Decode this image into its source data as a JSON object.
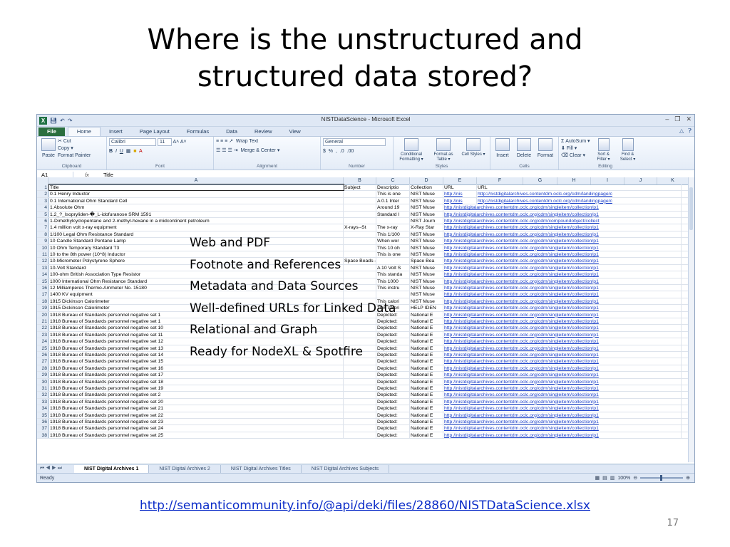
{
  "slide": {
    "title_line1": "Where is the unstructured and",
    "title_line2": "structured data stored?",
    "bullets": [
      "Web and PDF",
      "Footnote and References",
      "Metadata and Data Sources",
      "Well-defined URLs for Linked Data",
      "Relational and Graph",
      "Ready for NodeXL & Spotfire"
    ],
    "link": "http://semanticommunity.info/@api/deki/files/28860/NISTDataScience.xlsx",
    "page_number": "17"
  },
  "excel": {
    "window_title": "NISTDataScience  -  Microsoft Excel",
    "tabs": [
      "File",
      "Home",
      "Insert",
      "Page Layout",
      "Formulas",
      "Data",
      "Review",
      "View"
    ],
    "ribbon": {
      "clipboard": {
        "paste": "Paste",
        "cut": "Cut",
        "copy": "Copy ▾",
        "format_painter": "Format Painter",
        "label": "Clipboard"
      },
      "font": {
        "name": "Calibri",
        "size": "11",
        "label": "Font"
      },
      "alignment": {
        "wrap": "Wrap Text",
        "merge": "Merge & Center ▾",
        "label": "Alignment"
      },
      "number": {
        "format": "General",
        "label": "Number"
      },
      "styles": {
        "conditional": "Conditional Formatting ▾",
        "format_table": "Format as Table ▾",
        "cell_styles": "Cell Styles ▾",
        "label": "Styles"
      },
      "cells": {
        "insert": "Insert",
        "delete": "Delete",
        "format": "Format",
        "label": "Cells"
      },
      "editing": {
        "autosum": "AutoSum ▾",
        "fill": "Fill ▾",
        "clear": "Clear ▾",
        "sort": "Sort & Filter ▾",
        "find": "Find & Select ▾",
        "label": "Editing"
      }
    },
    "formula_bar": {
      "name_box": "A1",
      "fx": "fx",
      "content": "Title"
    },
    "columns": [
      "A",
      "B",
      "C",
      "D",
      "E",
      "F",
      "G",
      "H",
      "I",
      "J",
      "K"
    ],
    "rows": [
      [
        "1",
        "Title",
        "Subject",
        "Descriptio",
        "Collection",
        "URL",
        "URL"
      ],
      [
        "2",
        "0.1 Henry Inductor",
        "",
        "This is one",
        "NIST Muse",
        "http://nis",
        "http://nistdigitalarchives.contentdm.oclc.org/cdm/landingpage/c"
      ],
      [
        "3",
        "0.1 International Ohm Standard Cell",
        "",
        "A 0.1 Inter",
        "NIST Muse",
        "http://nis",
        "http://nistdigitalarchives.contentdm.oclc.org/cdm/landingpage/c"
      ],
      [
        "4",
        "1 Absolute Ohm",
        "",
        "Around 19",
        "NIST Muse",
        "http://nistdigitalarchives.contentdm.oclc.org/cdm/singleitem/collection/p1",
        ""
      ],
      [
        "5",
        "1,2_?_Isopryliden-�_L-idofuranose SRM 1591",
        "",
        "Standard I",
        "NIST Muse",
        "http://nistdigitalarchives.contentdm.oclc.org/cdm/singleitem/collection/p1",
        ""
      ],
      [
        "6",
        "1-Dimethylcyclopentane and 2-methyl-hexane in a midcontinent petroleum",
        "",
        "",
        "NIST Journ",
        "http://nistdigitalarchives.contentdm.oclc.org/cdm/compoundobject/collect",
        ""
      ],
      [
        "7",
        "1.4 million volt x-ray equipment",
        "X-rays--St",
        "The x-ray",
        "X-Ray Star",
        "http://nistdigitalarchives.contentdm.oclc.org/cdm/singleitem/collection/p1",
        ""
      ],
      [
        "8",
        "1/100 Legal Ohm Resistance Standard",
        "",
        "This 1/100",
        "NIST Muse",
        "http://nistdigitalarchives.contentdm.oclc.org/cdm/singleitem/collection/p1",
        ""
      ],
      [
        "9",
        "10 Candle Standard Pentane Lamp",
        "",
        "When wor",
        "NIST Muse",
        "http://nistdigitalarchives.contentdm.oclc.org/cdm/singleitem/collection/p1",
        ""
      ],
      [
        "10",
        "10 Ohm Temporary Standard T3",
        "",
        "This 10 oh",
        "NIST Muse",
        "http://nistdigitalarchives.contentdm.oclc.org/cdm/singleitem/collection/p1",
        ""
      ],
      [
        "11",
        "10 to the 8th power (10^8) Inductor",
        "",
        "This is one",
        "NIST Muse",
        "http://nistdigitalarchives.contentdm.oclc.org/cdm/singleitem/collection/p1",
        ""
      ],
      [
        "12",
        "10-Micrometer Polystyrene Sphere",
        "Space Beads--Photo",
        "",
        "Space Bea",
        "http://nistdigitalarchives.contentdm.oclc.org/cdm/singleitem/collection/p1",
        ""
      ],
      [
        "13",
        "10-Volt Standard",
        "",
        "A 10 Volt S",
        "NIST Muse",
        "http://nistdigitalarchives.contentdm.oclc.org/cdm/singleitem/collection/p1",
        ""
      ],
      [
        "14",
        "100-ohm British Association Type Resistor",
        "",
        "This standa",
        "NIST Muse",
        "http://nistdigitalarchives.contentdm.oclc.org/cdm/singleitem/collection/p1",
        ""
      ],
      [
        "15",
        "1000 International Ohm Resistance Standard",
        "",
        "This 1000",
        "NIST Muse",
        "http://nistdigitalarchives.contentdm.oclc.org/cdm/singleitem/collection/p1",
        ""
      ],
      [
        "16",
        "12 Milliamperes Thermo-Ammeter No. 15180",
        "",
        "This instru",
        "NIST Muse",
        "http://nistdigitalarchives.contentdm.oclc.org/cdm/singleitem/collection/p1",
        ""
      ],
      [
        "17",
        "1400 KV equipment",
        "",
        "",
        "NIST Muse",
        "http://nistdigitalarchives.contentdm.oclc.org/cdm/singleitem/collection/p1",
        ""
      ],
      [
        "18",
        "1915 Dickinson Calorimeter",
        "",
        "This calori",
        "NIST Muse",
        "http://nistdigitalarchives.contentdm.oclc.org/cdm/singleitem/collection/p1",
        ""
      ],
      [
        "19",
        "1915 Dickinson Calorimeter",
        "",
        "This calori",
        "HELP IDEN",
        "http://nistdigitalarchives.contentdm.oclc.org/cdm/singleitem/collection/p1",
        ""
      ],
      [
        "20",
        "1918 Bureau of Standards personnel negative set 1",
        "",
        "Depicted:",
        "National E",
        "http://nistdigitalarchives.contentdm.oclc.org/cdm/singleitem/collection/p1",
        ""
      ],
      [
        "21",
        "1918 Bureau of Standards personnel negative set 1",
        "",
        "Depicted:",
        "National E",
        "http://nistdigitalarchives.contentdm.oclc.org/cdm/singleitem/collection/p1",
        ""
      ],
      [
        "22",
        "1918 Bureau of Standards personnel negative set 10",
        "",
        "Depicted:",
        "National E",
        "http://nistdigitalarchives.contentdm.oclc.org/cdm/singleitem/collection/p1",
        ""
      ],
      [
        "23",
        "1918 Bureau of Standards personnel negative set 11",
        "",
        "Depicted:",
        "National E",
        "http://nistdigitalarchives.contentdm.oclc.org/cdm/singleitem/collection/p1",
        ""
      ],
      [
        "24",
        "1918 Bureau of Standards personnel negative set 12",
        "",
        "Depicted:",
        "National E",
        "http://nistdigitalarchives.contentdm.oclc.org/cdm/singleitem/collection/p1",
        ""
      ],
      [
        "25",
        "1918 Bureau of Standards personnel negative set 13",
        "",
        "Depicted:",
        "National E",
        "http://nistdigitalarchives.contentdm.oclc.org/cdm/singleitem/collection/p1",
        ""
      ],
      [
        "26",
        "1918 Bureau of Standards personnel negative set 14",
        "",
        "Depicted:",
        "National E",
        "http://nistdigitalarchives.contentdm.oclc.org/cdm/singleitem/collection/p1",
        ""
      ],
      [
        "27",
        "1918 Bureau of Standards personnel negative set 15",
        "",
        "Depicted:",
        "National E",
        "http://nistdigitalarchives.contentdm.oclc.org/cdm/singleitem/collection/p1",
        ""
      ],
      [
        "28",
        "1918 Bureau of Standards personnel negative set 16",
        "",
        "Depicted:",
        "National E",
        "http://nistdigitalarchives.contentdm.oclc.org/cdm/singleitem/collection/p1",
        ""
      ],
      [
        "29",
        "1918 Bureau of Standards personnel negative set 17",
        "",
        "Depicted:",
        "National E",
        "http://nistdigitalarchives.contentdm.oclc.org/cdm/singleitem/collection/p1",
        ""
      ],
      [
        "30",
        "1918 Bureau of Standards personnel negative set 18",
        "",
        "Depicted:",
        "National E",
        "http://nistdigitalarchives.contentdm.oclc.org/cdm/singleitem/collection/p1",
        ""
      ],
      [
        "31",
        "1918 Bureau of Standards personnel negative set 19",
        "",
        "Depicted:",
        "National E",
        "http://nistdigitalarchives.contentdm.oclc.org/cdm/singleitem/collection/p1",
        ""
      ],
      [
        "32",
        "1918 Bureau of Standards personnel negative set 2",
        "",
        "Depicted:",
        "National E",
        "http://nistdigitalarchives.contentdm.oclc.org/cdm/singleitem/collection/p1",
        ""
      ],
      [
        "33",
        "1918 Bureau of Standards personnel negative set 20",
        "",
        "Depicted:",
        "National E",
        "http://nistdigitalarchives.contentdm.oclc.org/cdm/singleitem/collection/p1",
        ""
      ],
      [
        "34",
        "1918 Bureau of Standards personnel negative set 21",
        "",
        "Depicted:",
        "National E",
        "http://nistdigitalarchives.contentdm.oclc.org/cdm/singleitem/collection/p1",
        ""
      ],
      [
        "35",
        "1918 Bureau of Standards personnel negative set 22",
        "",
        "Depicted:",
        "National E",
        "http://nistdigitalarchives.contentdm.oclc.org/cdm/singleitem/collection/p1",
        ""
      ],
      [
        "36",
        "1918 Bureau of Standards personnel negative set 23",
        "",
        "Depicted:",
        "National E",
        "http://nistdigitalarchives.contentdm.oclc.org/cdm/singleitem/collection/p1",
        ""
      ],
      [
        "37",
        "1918 Bureau of Standards personnel negative set 24",
        "",
        "Depicted:",
        "National E",
        "http://nistdigitalarchives.contentdm.oclc.org/cdm/singleitem/collection/p1",
        ""
      ],
      [
        "38",
        "1918 Bureau of Standards personnel negative set 25",
        "",
        "Depicted:",
        "National E",
        "http://nistdigitalarchives.contentdm.oclc.org/cdm/singleitem/collection/p1",
        ""
      ]
    ],
    "sheet_tabs": [
      "NIST Digital Archives 1",
      "NIST Digital Archives 2",
      "NIST Digital Archives Titles",
      "NIST Digital Archives Subjects"
    ],
    "status": "Ready",
    "zoom": "100%"
  }
}
